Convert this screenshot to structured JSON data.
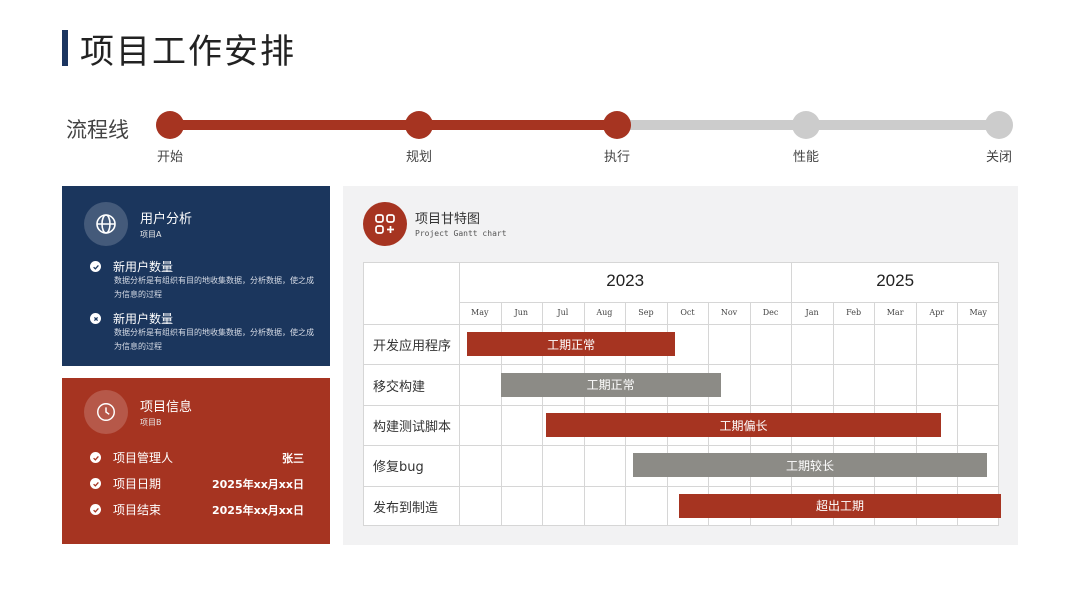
{
  "header": {
    "title": "项目工作安排"
  },
  "flow": {
    "label": "流程线",
    "active_color": "#a63421",
    "inactive_color": "#cccccc",
    "current_index": 2,
    "steps": [
      {
        "label": "开始"
      },
      {
        "label": "规划"
      },
      {
        "label": "执行"
      },
      {
        "label": "性能"
      },
      {
        "label": "关闭"
      }
    ]
  },
  "user_card": {
    "icon": "globe-icon",
    "title": "用户分析",
    "subtitle": "项目A",
    "items": [
      {
        "icon": "check-icon",
        "label": "新用户数量",
        "desc": "数据分析是有组织有目的地收集数据，分析数据，使之成为信息的过程"
      },
      {
        "icon": "cross-icon",
        "label": "新用户数量",
        "desc": "数据分析是有组织有目的地收集数据，分析数据，使之成为信息的过程"
      }
    ]
  },
  "info_card": {
    "icon": "clock-icon",
    "title": "项目信息",
    "subtitle": "项目B",
    "rows": [
      {
        "label": "项目管理人",
        "value": "张三"
      },
      {
        "label": "项目日期",
        "value": "2025年xx月xx日"
      },
      {
        "label": "项目结束",
        "value": "2025年xx月xx日"
      }
    ]
  },
  "gantt": {
    "icon": "apps-add-icon",
    "title": "项目甘特图",
    "subtitle": "Project Gantt chart",
    "years": [
      {
        "label": "2023",
        "span": 8
      },
      {
        "label": "2025",
        "span": 5
      }
    ],
    "months": [
      "May",
      "Jun",
      "Jul",
      "Aug",
      "Sep",
      "Oct",
      "Nov",
      "Dec",
      "Jan",
      "Feb",
      "Mar",
      "Apr",
      "May"
    ],
    "colors": {
      "red": "#a63421",
      "gray": "#8c8b86"
    },
    "tasks": [
      {
        "name": "开发应用程序",
        "start": 0.2,
        "end": 5.2,
        "status": "工期正常",
        "color": "red"
      },
      {
        "name": "移交构建",
        "start": 1.0,
        "end": 6.3,
        "status": "工期正常",
        "color": "gray"
      },
      {
        "name": "构建测试脚本",
        "start": 2.1,
        "end": 11.6,
        "status": "工期偏长",
        "color": "red"
      },
      {
        "name": "修复bug",
        "start": 4.2,
        "end": 12.7,
        "status": "工期较长",
        "color": "gray"
      },
      {
        "name": "发布到制造",
        "start": 5.3,
        "end": 13.2,
        "status": "超出工期",
        "color": "red"
      }
    ]
  }
}
